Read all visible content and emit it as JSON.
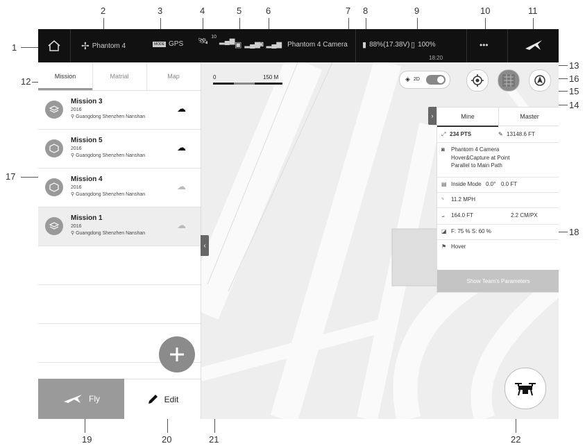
{
  "callouts": [
    "1",
    "2",
    "3",
    "4",
    "5",
    "6",
    "7",
    "8",
    "9",
    "10",
    "11",
    "12",
    "13",
    "14",
    "15",
    "16",
    "17",
    "18",
    "19",
    "20",
    "21",
    "22"
  ],
  "topbar": {
    "aircraft": "Phantom 4",
    "mode": "GPS",
    "mode_badge": "MODE",
    "satellites": "10",
    "camera": "Phantom 4 Camera",
    "battery": "88%(17.38V)",
    "device_battery": "100%",
    "time": "18:20",
    "more": "•••"
  },
  "tabs": [
    "Mission",
    "Matrial",
    "Map"
  ],
  "missions": [
    {
      "name": "Mission 3",
      "year": "2016",
      "location": "Guangdong Shenzhen Nanshan"
    },
    {
      "name": "Mission 5",
      "year": "2016",
      "location": "Guangdong Shenzhen Nanshan"
    },
    {
      "name": "Mission 4",
      "year": "2016",
      "location": "Guangdong Shenzhen Nanshan"
    },
    {
      "name": "Mission 1",
      "year": "2016",
      "location": "Guangdong Shenzhen Nanshan"
    }
  ],
  "buttons": {
    "fly": "Fly",
    "edit": "Edit"
  },
  "scale": {
    "start": "0",
    "end": "150 M"
  },
  "toggle": {
    "label": "2D"
  },
  "params": {
    "tabs": [
      "Mine",
      "Master"
    ],
    "points": "234 PTS",
    "distance": "13148.6 FT",
    "camera": "Phantom 4 Camera",
    "action": "Hover&Capture at Point",
    "path": "Parallel to Main Path",
    "mode": "Inside Mode",
    "mode_angle": "0.0°",
    "mode_dist": "0.0 FT",
    "speed": "11.2 MPH",
    "altitude": "164.0 FT",
    "gsd": "2.2 CM/PX",
    "overlap": "F: 75 %   S: 60 %",
    "finish": "Hover",
    "show_team": "Show Team's Parameters"
  }
}
